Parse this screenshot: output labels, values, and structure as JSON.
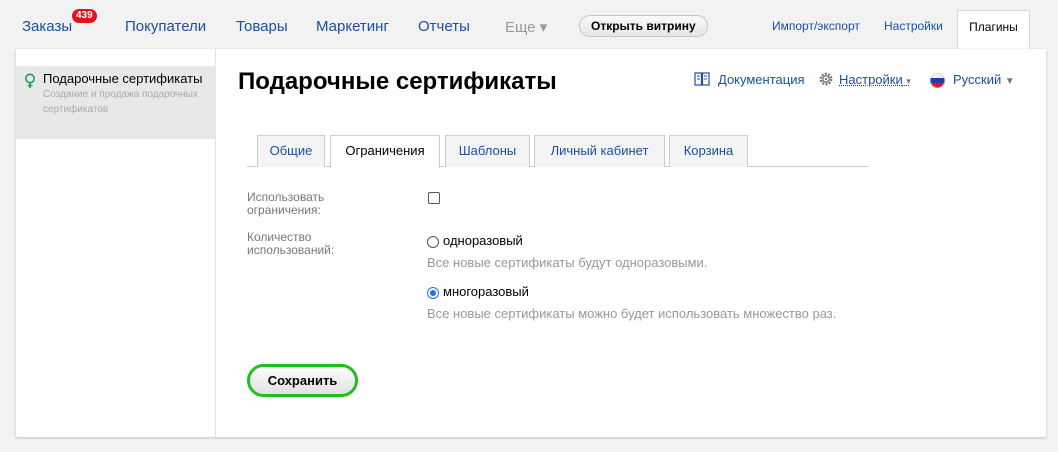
{
  "nav": {
    "orders": "Заказы",
    "orders_badge": "439",
    "customers": "Покупатели",
    "products": "Товары",
    "marketing": "Маркетинг",
    "reports": "Отчеты",
    "more": "Еще ▾",
    "storefront": "Открыть витрину",
    "import_export": "Импорт/экспорт",
    "settings": "Настройки",
    "plugins": "Плагины"
  },
  "sidebar": {
    "items": [
      {
        "title": "Подарочные сертификаты",
        "desc": "Создание и продажа подарочных сертификатов"
      }
    ]
  },
  "page": {
    "title": "Подарочные сертификаты",
    "docs": "Документация",
    "settings": "Настройки",
    "language": "Русский"
  },
  "tabs": [
    {
      "label": "Общие"
    },
    {
      "label": "Ограничения"
    },
    {
      "label": "Шаблоны"
    },
    {
      "label": "Личный кабинет"
    },
    {
      "label": "Корзина"
    }
  ],
  "form": {
    "use_limits_label": "Использовать ограничения:",
    "use_limits_checked": false,
    "usage_count_label": "Количество использований:",
    "option_single": "одноразовый",
    "option_single_hint": "Все новые сертификаты будут одноразовыми.",
    "option_multi": "многоразовый",
    "option_multi_hint": "Все новые сертификаты можно будет использовать множество раз.",
    "selected_option": "многоразовый",
    "save": "Сохранить"
  },
  "colors": {
    "link": "#1a4fa3",
    "badge": "#e0141e",
    "save_border": "#20c020",
    "radio_checked": "#1a73e8"
  }
}
